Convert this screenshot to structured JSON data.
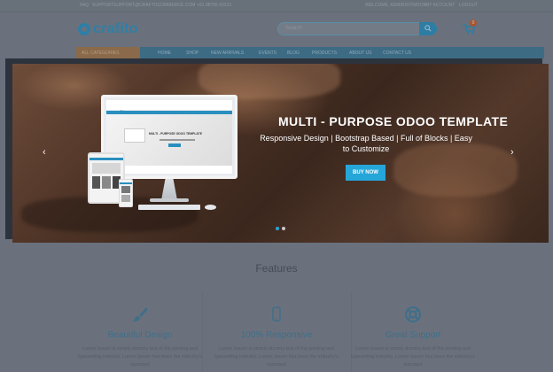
{
  "topbar": {
    "left_links": [
      "FAQ",
      "SUPPORT",
      "SUPPORT@CRAFTOCOMMERCE.COM",
      "+91 98765 43210"
    ],
    "welcome_text": "WELCOME, ADMINISTRATOR",
    "right_links": [
      "MY ACCOUNT",
      "LOGOUT"
    ]
  },
  "header": {
    "logo_text": "crafito",
    "search_placeholder": "Search",
    "cart_count": "0"
  },
  "nav": {
    "category_label": "ALL CATEGORIES",
    "items": [
      "HOME",
      "SHOP",
      "NEW ARRIVALS",
      "EVENTS",
      "BLOG",
      "PRODUCTS",
      "ABOUT US",
      "CONTACT US"
    ]
  },
  "hero": {
    "title": "MULTI - PURPOSE ODOO TEMPLATE",
    "subtitle": "Responsive Design | Bootstrap Based | Full of Blocks | Easy to Customize",
    "button_label": "BUY NOW",
    "prev_arrow": "‹",
    "next_arrow": "›",
    "slide_count": 2,
    "active_slide": 1,
    "mockup": {
      "logo": "crafito",
      "headline": "MULTI - PURPOSE ODOO TEMPLATE"
    }
  },
  "features": {
    "title": "Features",
    "items": [
      {
        "icon": "brush-icon",
        "title": "Beautiful Design",
        "text": "Lorem Ipsum is simply dummy text of the printing and typesetting industry. Lorem Ipsum has been the industry's standard"
      },
      {
        "icon": "mobile-icon",
        "title": "100% Responsive",
        "text": "Lorem Ipsum is simply dummy text of the printing and typesetting industry. Lorem Ipsum has been the industry's standard"
      },
      {
        "icon": "lifebuoy-icon",
        "title": "Great Support",
        "text": "Lorem Ipsum is simply dummy text of the printing and typesetting industry. Lorem Ipsum has been the industry's standard"
      }
    ]
  },
  "colors": {
    "accent": "#25a6d9",
    "overlay": "#6a717d",
    "brand": "#2e7fa6"
  }
}
